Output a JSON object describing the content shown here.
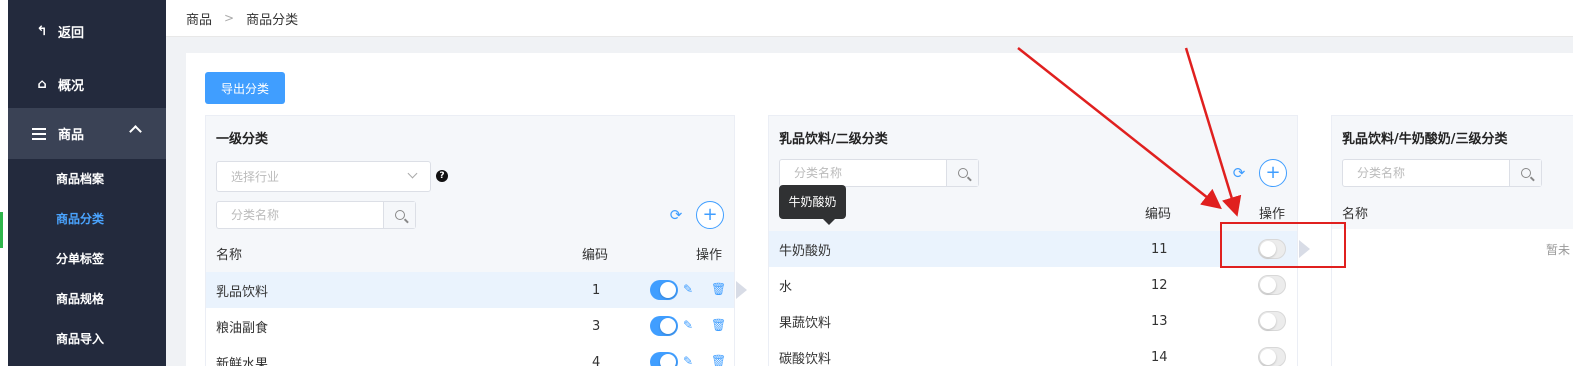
{
  "sidebar": {
    "back_label": "返回",
    "overview_label": "概况",
    "group_label": "商品",
    "items": [
      {
        "label": "商品档案"
      },
      {
        "label": "商品分类"
      },
      {
        "label": "分单标签"
      },
      {
        "label": "商品规格"
      },
      {
        "label": "商品导入"
      }
    ],
    "active_color": "#4aa4ff"
  },
  "breadcrumb": {
    "root": "商品",
    "separator": ">",
    "current": "商品分类"
  },
  "toolbar": {
    "export_label": "导出分类",
    "accent": "#409eff"
  },
  "level1": {
    "title": "一级分类",
    "industry_placeholder": "选择行业",
    "help_label": "?",
    "search_placeholder": "分类名称",
    "col_name": "名称",
    "col_code": "编码",
    "col_actions": "操作",
    "rows": [
      {
        "name": "乳品饮料",
        "code": "1",
        "enabled": true
      },
      {
        "name": "粮油副食",
        "code": "3",
        "enabled": true
      },
      {
        "name": "新鲜水果",
        "code": "4",
        "enabled": true
      }
    ]
  },
  "level2": {
    "title": "乳品饮料/二级分类",
    "search_placeholder": "分类名称",
    "tooltip": "牛奶酸奶",
    "col_code": "编码",
    "col_actions": "操作",
    "rows": [
      {
        "name": "牛奶酸奶",
        "code": "11",
        "enabled": false
      },
      {
        "name": "水",
        "code": "12",
        "enabled": false
      },
      {
        "name": "果蔬饮料",
        "code": "13",
        "enabled": false
      },
      {
        "name": "碳酸饮料",
        "code": "14",
        "enabled": false
      }
    ]
  },
  "level3": {
    "title": "乳品饮料/牛奶酸奶/三级分类",
    "search_placeholder": "分类名称",
    "col_name": "名称",
    "empty_text": "暂未"
  },
  "annotation_color": "#e0201f"
}
